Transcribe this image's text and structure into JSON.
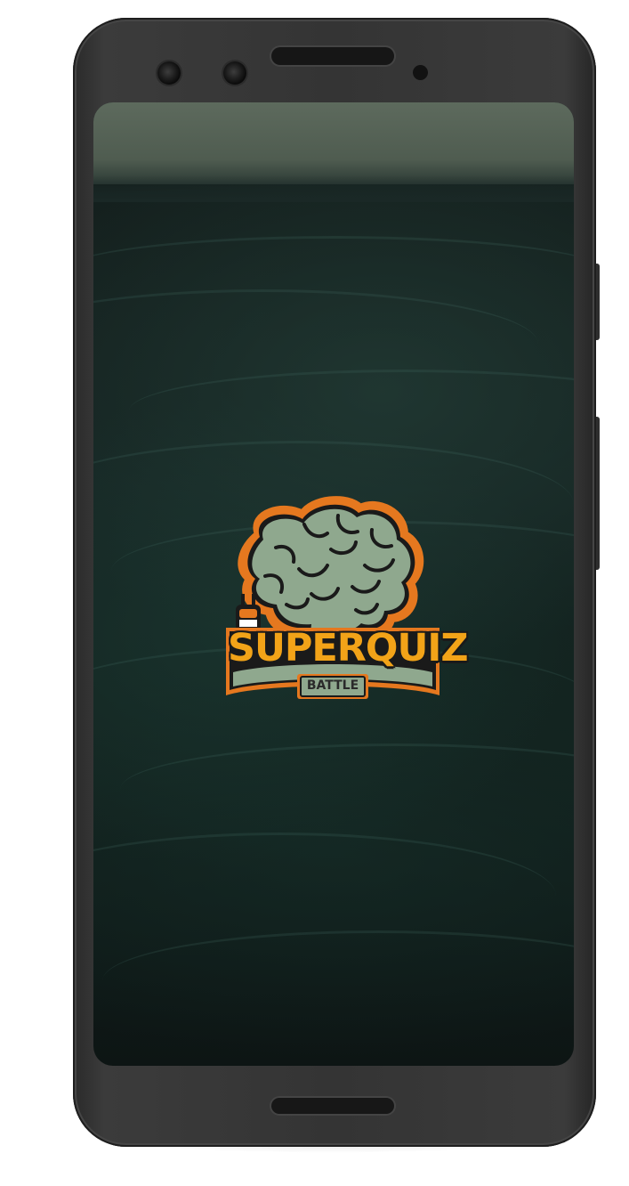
{
  "app": {
    "title_line1": "SUPERQUIZ",
    "title_line2": "BATTLE"
  },
  "icons": {
    "logo": "brain-logo-icon",
    "plug": "plug-icon"
  },
  "colors": {
    "brain": "#8fa88e",
    "outline": "#1a1a1a",
    "accent_orange": "#e5781f",
    "title_gold": "#f2a318",
    "background_sea": "#152422",
    "device_body": "#343434"
  }
}
